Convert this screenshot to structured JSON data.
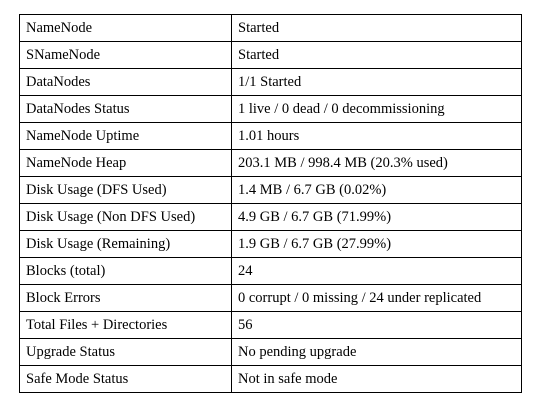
{
  "rows": [
    {
      "label": "NameNode",
      "value": "Started"
    },
    {
      "label": "SNameNode",
      "value": "Started"
    },
    {
      "label": "DataNodes",
      "value": "1/1 Started"
    },
    {
      "label": "DataNodes Status",
      "value": "1 live / 0 dead / 0 decommissioning"
    },
    {
      "label": "NameNode Uptime",
      "value": "1.01 hours"
    },
    {
      "label": "NameNode Heap",
      "value": "203.1 MB / 998.4 MB (20.3% used)"
    },
    {
      "label": "Disk Usage (DFS Used)",
      "value": "1.4 MB / 6.7 GB (0.02%)"
    },
    {
      "label": "Disk Usage (Non DFS Used)",
      "value": "4.9 GB / 6.7 GB (71.99%)"
    },
    {
      "label": "Disk Usage (Remaining)",
      "value": "1.9 GB / 6.7 GB (27.99%)"
    },
    {
      "label": "Blocks (total)",
      "value": "24"
    },
    {
      "label": "Block Errors",
      "value": "0 corrupt / 0 missing / 24 under replicated"
    },
    {
      "label": "Total Files + Directories",
      "value": "56"
    },
    {
      "label": "Upgrade Status",
      "value": "No pending upgrade"
    },
    {
      "label": "Safe Mode Status",
      "value": "Not in safe mode"
    }
  ]
}
